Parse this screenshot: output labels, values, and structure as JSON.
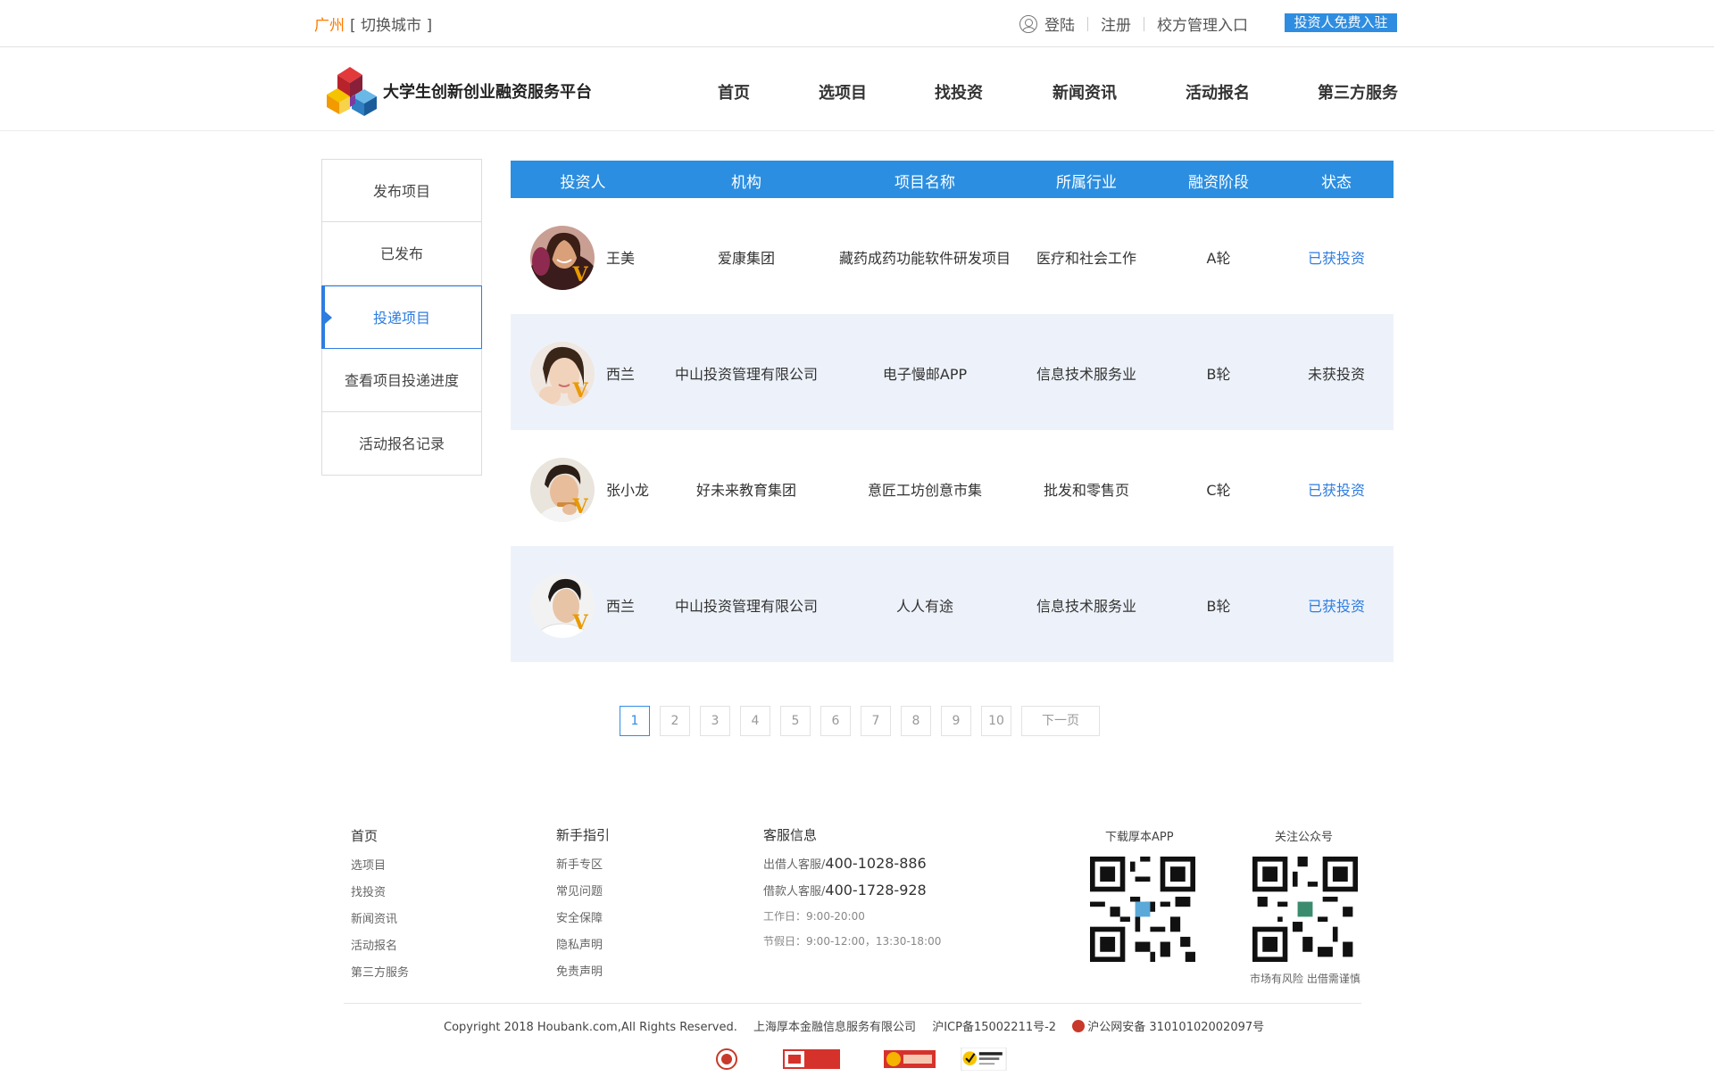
{
  "topbar": {
    "city": "广州",
    "switch_city": "[ 切换城市 ]",
    "login": "登陆",
    "register": "注册",
    "school_entry": "校方管理入口",
    "investor_join": "投资人免费入驻"
  },
  "header": {
    "brand": "大学生创新创业融资服务平台",
    "nav": [
      "首页",
      "选项目",
      "找投资",
      "新闻资讯",
      "活动报名",
      "第三方服务"
    ]
  },
  "sidebar": {
    "items": [
      "发布项目",
      "已发布",
      "投递项目",
      "查看项目投递进度",
      "活动报名记录"
    ],
    "active_index": 2
  },
  "table": {
    "columns": [
      "投资人",
      "机构",
      "项目名称",
      "所属行业",
      "融资阶段",
      "状态"
    ],
    "rows": [
      {
        "investor": "王美",
        "org": "爱康集团",
        "project": "藏药成药功能软件研发项目",
        "industry": "医疗和社会工作",
        "stage": "A轮",
        "status": "已获投资",
        "invested": true
      },
      {
        "investor": "西兰",
        "org": "中山投资管理有限公司",
        "project": "电子慢邮APP",
        "industry": "信息技术服务业",
        "stage": "B轮",
        "status": "未获投资",
        "invested": false
      },
      {
        "investor": "张小龙",
        "org": "好未来教育集团",
        "project": "意匠工坊创意市集",
        "industry": "批发和零售页",
        "stage": "C轮",
        "status": "已获投资",
        "invested": true
      },
      {
        "investor": "西兰",
        "org": "中山投资管理有限公司",
        "project": "人人有途",
        "industry": "信息技术服务业",
        "stage": "B轮",
        "status": "已获投资",
        "invested": true
      }
    ],
    "verified_badge": "V"
  },
  "pagination": {
    "pages": [
      "1",
      "2",
      "3",
      "4",
      "5",
      "6",
      "7",
      "8",
      "9",
      "10"
    ],
    "current": "1",
    "next": "下一页"
  },
  "footer": {
    "col1": {
      "title": "首页",
      "items": [
        "选项目",
        "找投资",
        "新闻资讯",
        "活动报名",
        "第三方服务"
      ]
    },
    "col2": {
      "title": "新手指引",
      "items": [
        "新手专区",
        "常见问题",
        "安全保障",
        "隐私声明",
        "免责声明"
      ]
    },
    "service": {
      "title": "客服信息",
      "lender_label": "出借人客服/",
      "lender_phone": "400-1028-886",
      "borrower_label": "借款人客服/",
      "borrower_phone": "400-1728-928",
      "workday": "工作日：9:00-20:00",
      "holiday": "节假日：9:00-12:00，13:30-18:00"
    },
    "app_qr_label": "下载厚本APP",
    "wechat_qr_label": "关注公众号",
    "risk_note": "市场有风险 出借需谨慎",
    "copyright": "Copyright 2018 Houbank.com,All Rights Reserved.",
    "company": "上海厚本金融信息服务有限公司",
    "icp": "沪ICP备15002211号-2",
    "police": "沪公网安备 31010102002097号"
  },
  "colors": {
    "accent": "#2b8ee0",
    "city": "#ff7a00",
    "badge": "#e89a00",
    "alt_row": "#edf2fa"
  }
}
